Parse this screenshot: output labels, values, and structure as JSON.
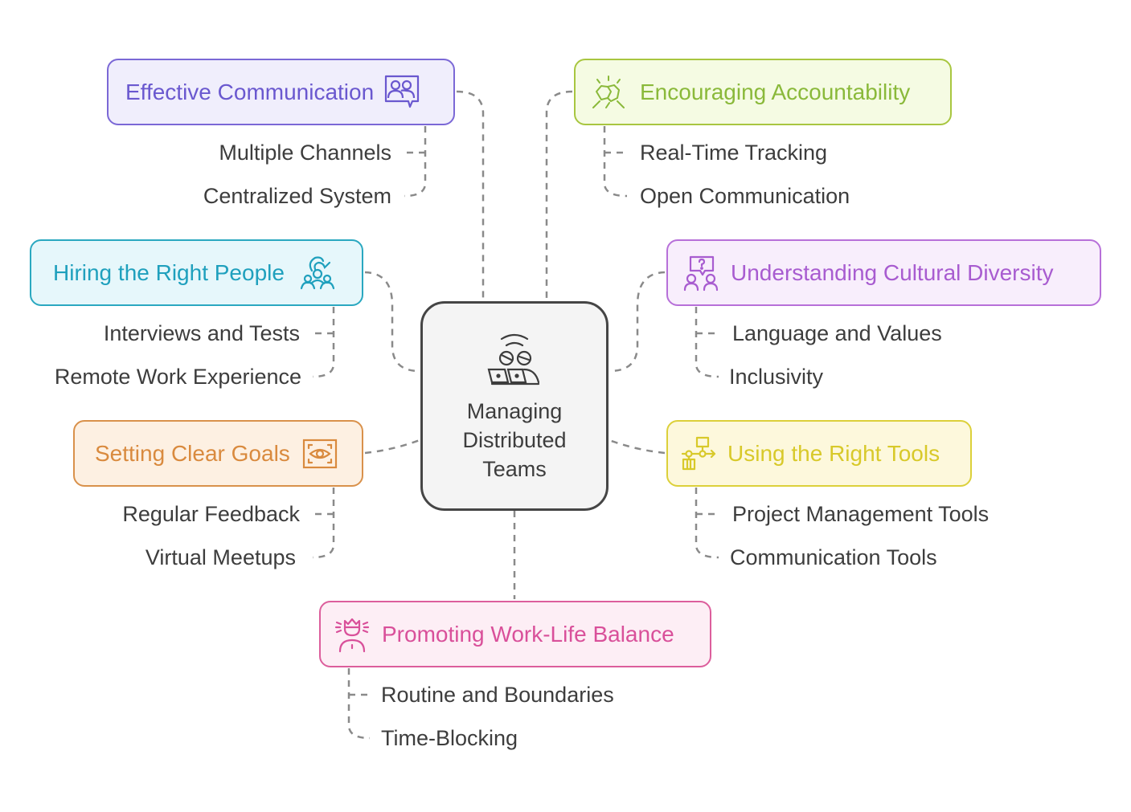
{
  "center": {
    "title": "Managing Distributed Teams",
    "icon": "remote-team-icon"
  },
  "branches": {
    "communication": {
      "title": "Effective Communication",
      "icon": "people-chat-icon",
      "color": "#6a58cf",
      "items": [
        "Multiple Channels",
        "Centralized System"
      ]
    },
    "accountability": {
      "title": "Encouraging Accountability",
      "icon": "handshake-icon",
      "color": "#8ab93a",
      "items": [
        "Real-Time Tracking",
        "Open Communication"
      ]
    },
    "hiring": {
      "title": "Hiring the Right People",
      "icon": "team-recruit-icon",
      "color": "#1fa0bd",
      "items": [
        "Interviews and Tests",
        "Remote Work Experience"
      ]
    },
    "culture": {
      "title": "Understanding Cultural Diversity",
      "icon": "people-question-icon",
      "color": "#a85cd0",
      "items": [
        "Language and Values",
        "Inclusivity"
      ]
    },
    "goals": {
      "title": "Setting Clear Goals",
      "icon": "eye-focus-icon",
      "color": "#d98a3e",
      "items": [
        "Regular Feedback",
        "Virtual Meetups"
      ]
    },
    "tools": {
      "title": "Using the Right Tools",
      "icon": "workflow-icon",
      "color": "#d8c92a",
      "items": [
        "Project Management Tools",
        "Communication Tools"
      ]
    },
    "worklife": {
      "title": "Promoting Work-Life Balance",
      "icon": "person-balance-icon",
      "color": "#d9509a",
      "items": [
        "Routine and Boundaries",
        "Time-Blocking"
      ]
    }
  }
}
